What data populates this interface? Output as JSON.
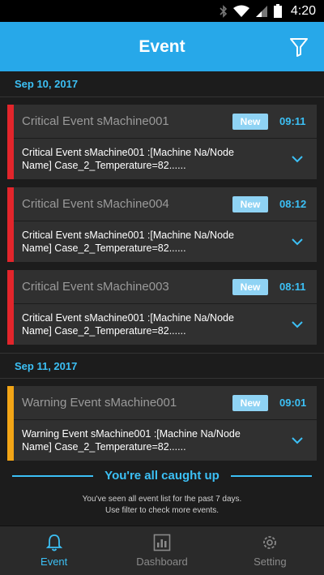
{
  "status_bar": {
    "time": "4:20"
  },
  "header": {
    "title": "Event"
  },
  "sections": [
    {
      "date": "Sep 10, 2017",
      "events": [
        {
          "severity": "critical",
          "title": "Critical Event sMachine001",
          "badge": "New",
          "time": "09:11",
          "message": "Critical Event sMachine001 :[Machine Na/Node Name] Case_2_Temperature=82......"
        },
        {
          "severity": "critical",
          "title": "Critical Event sMachine004",
          "badge": "New",
          "time": "08:12",
          "message": "Critical Event sMachine001 :[Machine Na/Node Name] Case_2_Temperature=82......"
        },
        {
          "severity": "critical",
          "title": "Critical Event sMachine003",
          "badge": "New",
          "time": "08:11",
          "message": "Critical Event sMachine001 :[Machine Na/Node Name] Case_2_Temperature=82......"
        }
      ]
    },
    {
      "date": "Sep 11, 2017",
      "events": [
        {
          "severity": "warning",
          "title": "Warning Event sMachine001",
          "badge": "New",
          "time": "09:01",
          "message": "Warning Event sMachine001 :[Machine Na/Node Name] Case_2_Temperature=82......"
        }
      ]
    }
  ],
  "caught_up": {
    "title": "You're all caught up",
    "line1": "You've seen all event list for the past 7 days.",
    "line2": "Use filter to check more events."
  },
  "nav": {
    "items": [
      {
        "label": "Event",
        "icon": "bell-icon",
        "active": true
      },
      {
        "label": "Dashboard",
        "icon": "dashboard-icon",
        "active": false
      },
      {
        "label": "Setting",
        "icon": "gear-icon",
        "active": false
      }
    ]
  },
  "colors": {
    "accent": "#27a8e9",
    "critical": "#e2252b",
    "warning": "#f2a516",
    "badge": "#8fd3f4",
    "time": "#3cc0f5"
  }
}
